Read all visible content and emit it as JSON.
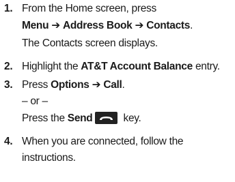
{
  "steps": [
    {
      "number": "1.",
      "line1": "From the Home screen, press",
      "path": [
        "Menu",
        "Address Book",
        "Contacts"
      ],
      "arrow": "➔",
      "path_end": ".",
      "result": "The Contacts screen displays."
    },
    {
      "number": "2.",
      "pre": "Highlight the ",
      "bold": "AT&T Account Balance",
      "post": " entry."
    },
    {
      "number": "3.",
      "pre": "Press ",
      "bold1": "Options",
      "arrow": "➔",
      "bold2": "Call",
      "post": ".",
      "or": "– or –",
      "send_pre": "Press the ",
      "send_bold": "Send",
      "send_post": " key."
    },
    {
      "number": "4.",
      "line1": "When you are connected, follow the",
      "line2": "instructions."
    }
  ],
  "icons": {
    "send_key": "send-key-icon"
  },
  "colors": {
    "text": "#1a1a1a",
    "key_fill": "#222222",
    "key_symbol": "#ffffff"
  }
}
